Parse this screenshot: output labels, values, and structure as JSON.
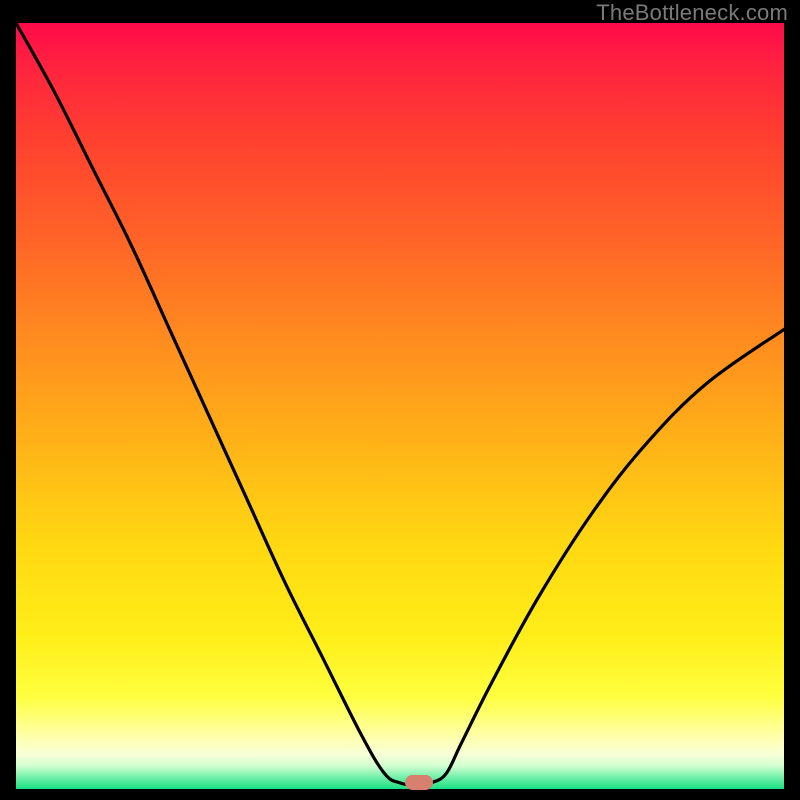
{
  "watermark": "TheBottleneck.com",
  "marker": {
    "cx_frac": 0.525,
    "cy_frac": 0.992
  },
  "chart_data": {
    "type": "line",
    "title": "",
    "xlabel": "",
    "ylabel": "",
    "xlim": [
      0,
      100
    ],
    "ylim": [
      0,
      100
    ],
    "series": [
      {
        "name": "bottleneck-curve",
        "x": [
          0,
          5,
          10,
          15,
          20,
          25,
          30,
          35,
          40,
          45,
          48,
          50,
          52,
          54,
          56,
          58,
          62,
          68,
          75,
          82,
          90,
          100
        ],
        "y": [
          100,
          91,
          81,
          71,
          60,
          49,
          38,
          27,
          17,
          7,
          2,
          0.8,
          0.5,
          0.8,
          2,
          6,
          14,
          25,
          36,
          45,
          53,
          60
        ]
      }
    ],
    "marker_x": 52.5,
    "colors": {
      "curve": "#000000",
      "marker": "#d88070",
      "top": "#ff0a4a",
      "bottom": "#18e082"
    }
  }
}
